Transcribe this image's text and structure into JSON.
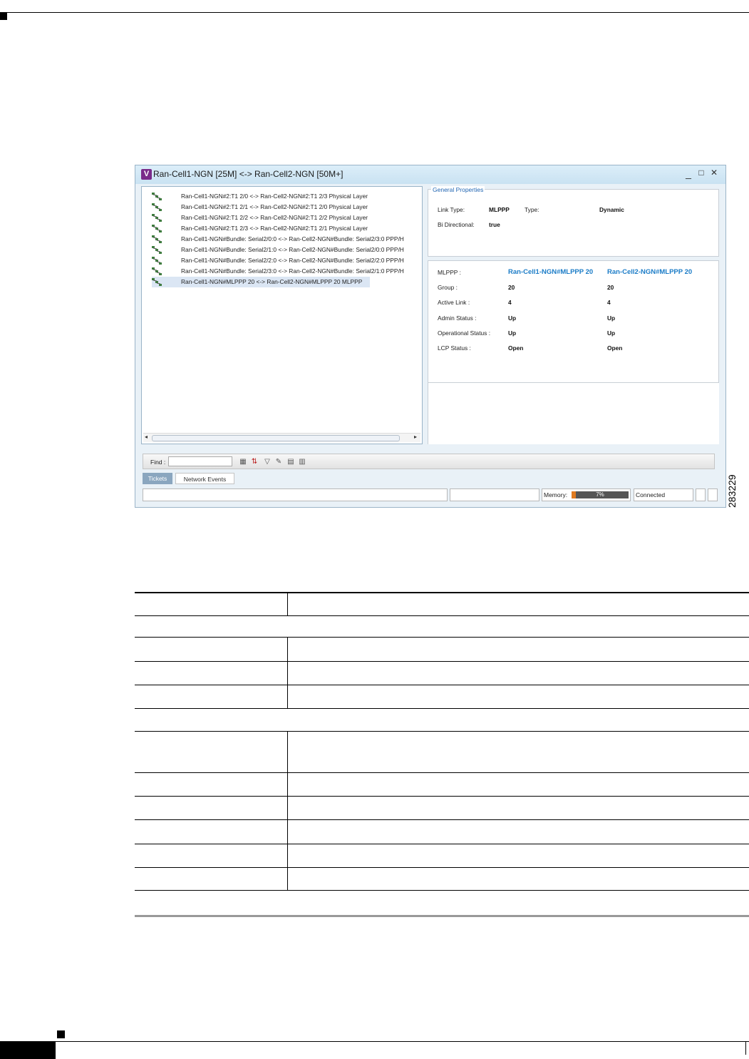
{
  "window": {
    "title": "Ran-Cell1-NGN [25M] <-> Ran-Cell2-NGN [50M+]",
    "controls": {
      "minimize": "_",
      "maximize": "□",
      "close": "✕"
    }
  },
  "tree": {
    "items": [
      {
        "label": "Ran-Cell1-NGN#2:T1 2/0 <-> Ran-Cell2-NGN#2:T1 2/3 Physical Layer",
        "icon": "link-icon"
      },
      {
        "label": "Ran-Cell1-NGN#2:T1 2/1 <-> Ran-Cell2-NGN#2:T1 2/0 Physical Layer",
        "icon": "link-icon"
      },
      {
        "label": "Ran-Cell1-NGN#2:T1 2/2 <-> Ran-Cell2-NGN#2:T1 2/2 Physical Layer",
        "icon": "link-icon"
      },
      {
        "label": "Ran-Cell1-NGN#2:T1 2/3 <-> Ran-Cell2-NGN#2:T1 2/1 Physical Layer",
        "icon": "link-icon"
      },
      {
        "label": "Ran-Cell1-NGN#Bundle: Serial2/0:0 <-> Ran-Cell2-NGN#Bundle: Serial2/3:0 PPP/H",
        "icon": "link-icon"
      },
      {
        "label": "Ran-Cell1-NGN#Bundle: Serial2/1:0 <-> Ran-Cell2-NGN#Bundle: Serial2/0:0 PPP/H",
        "icon": "link-icon"
      },
      {
        "label": "Ran-Cell1-NGN#Bundle: Serial2/2:0 <-> Ran-Cell2-NGN#Bundle: Serial2/2:0 PPP/H",
        "icon": "link-icon"
      },
      {
        "label": "Ran-Cell1-NGN#Bundle: Serial2/3:0 <-> Ran-Cell2-NGN#Bundle: Serial2/1:0 PPP/H",
        "icon": "link-icon"
      },
      {
        "label": "Ran-Cell1-NGN#MLPPP 20 <-> Ran-Cell2-NGN#MLPPP 20 MLPPP",
        "icon": "link-icon",
        "selected": true
      }
    ]
  },
  "general_properties": {
    "legend": "General Properties",
    "link_type_label": "Link Type:",
    "link_type_value": "MLPPP",
    "type_label": "Type:",
    "type_value": "Dynamic",
    "bi_directional_label": "Bi Directional:",
    "bi_directional_value": "true"
  },
  "mlppp": {
    "mlppp_label": "MLPPP :",
    "endpoint_a": "Ran-Cell1-NGN#MLPPP 20",
    "endpoint_b": "Ran-Cell2-NGN#MLPPP 20",
    "rows": [
      {
        "label": "Group :",
        "a": "20",
        "b": "20"
      },
      {
        "label": "Active Link :",
        "a": "4",
        "b": "4"
      },
      {
        "label": "Admin Status :",
        "a": "Up",
        "b": "Up"
      },
      {
        "label": "Operational Status :",
        "a": "Up",
        "b": "Up"
      },
      {
        "label": "LCP Status :",
        "a": "Open",
        "b": "Open"
      }
    ]
  },
  "find": {
    "label": "Find :",
    "value": ""
  },
  "tabs": {
    "tickets": "Tickets",
    "network_events": "Network Events"
  },
  "status": {
    "memory_label": "Memory:",
    "memory_percent": 7,
    "memory_text": "7%",
    "connection": "Connected"
  },
  "figure_id": "283229"
}
